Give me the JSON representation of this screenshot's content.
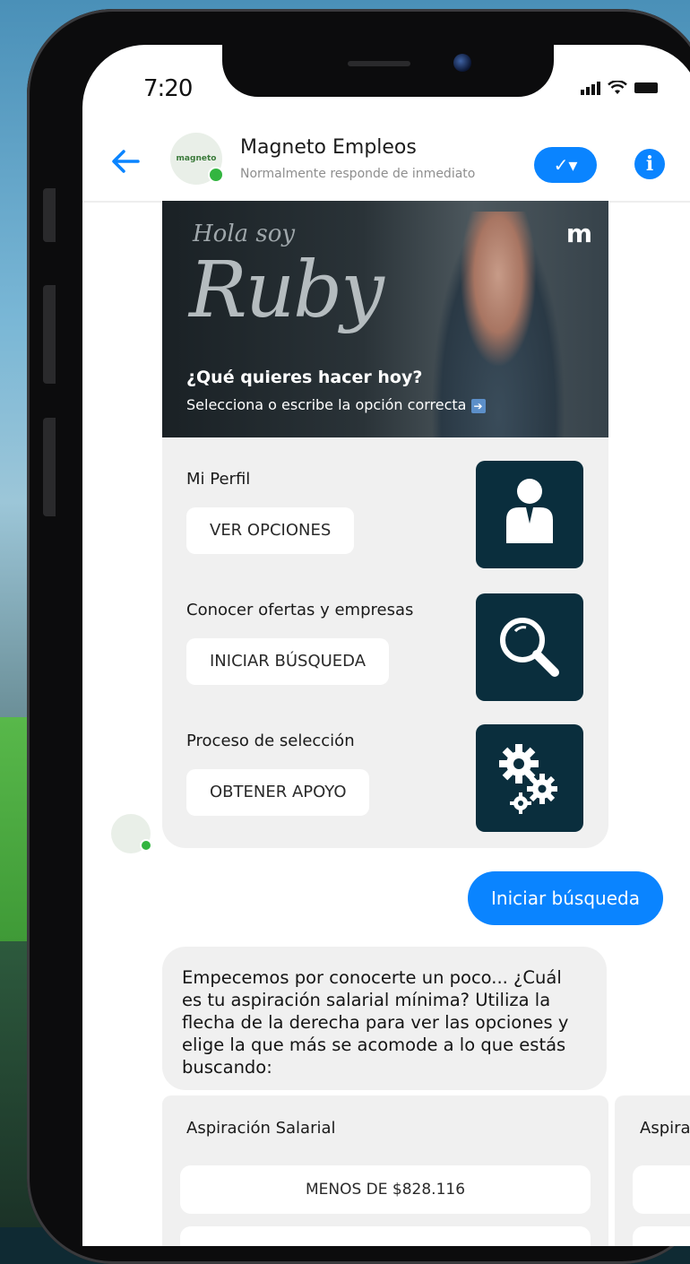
{
  "status": {
    "time": "7:20"
  },
  "header": {
    "page_name": "Magneto Empleos",
    "page_status": "Normalmente responde de inmediato",
    "check_label": "✓▾",
    "info_label": "i",
    "avatar_logo": "magneto"
  },
  "hero": {
    "hola": "Hola soy",
    "name": "Ruby",
    "brand_mark": "m",
    "question": "¿Qué quieres hacer hoy?",
    "subtitle": "Selecciona o escribe la opción correcta",
    "arrow_icon": "arrow-right-icon"
  },
  "options": [
    {
      "title": "Mi Perfil",
      "button": "VER OPCIONES",
      "icon": "user-icon"
    },
    {
      "title": "Conocer ofertas y empresas",
      "button": "INICIAR BÚSQUEDA",
      "icon": "search-icon"
    },
    {
      "title": "Proceso de selección",
      "button": "OBTENER APOYO",
      "icon": "gears-icon"
    }
  ],
  "user_message": "Iniciar búsqueda",
  "bot_message": "Empecemos por conocerte un poco... ¿Cuál es tu aspiración salarial mínima? Utiliza la flecha de la derecha para ver las opciones y elige la que más se acomode a lo que estás buscando:",
  "salary": {
    "title": "Aspiración Salarial",
    "options": [
      "MENOS DE $828.116"
    ],
    "next_title_partial": "Aspirac"
  },
  "colors": {
    "accent": "#0a84ff",
    "icon_tile": "#0a2e3d",
    "online": "#33b540"
  }
}
